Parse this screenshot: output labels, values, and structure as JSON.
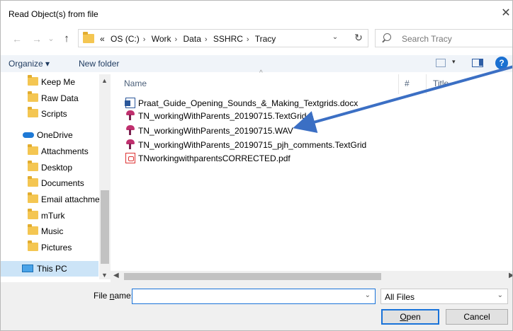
{
  "window": {
    "title": "Read Object(s) from file",
    "close_glyph": "✕"
  },
  "nav": {
    "back_glyph": "←",
    "forward_glyph": "→",
    "recent_glyph": "⌄",
    "up_glyph": "↑",
    "overflow": "«",
    "breadcrumbs": [
      "OS (C:)",
      "Work",
      "Data",
      "SSHRC",
      "Tracy"
    ],
    "sep": "›",
    "dropdown_glyph": "⌄",
    "refresh_glyph": "↻",
    "search_placeholder": "Search Tracy"
  },
  "toolbar": {
    "organize": "Organize ▾",
    "new_folder": "New folder",
    "view_dd": "▾",
    "help": "?"
  },
  "sidebar": {
    "items": [
      {
        "label": "Keep Me",
        "type": "folder"
      },
      {
        "label": "Raw Data",
        "type": "folder"
      },
      {
        "label": "Scripts",
        "type": "folder"
      },
      {
        "label": "OneDrive",
        "type": "onedrive"
      },
      {
        "label": "Attachments",
        "type": "folder"
      },
      {
        "label": "Desktop",
        "type": "folder"
      },
      {
        "label": "Documents",
        "type": "folder"
      },
      {
        "label": "Email attachmer",
        "type": "folder"
      },
      {
        "label": "mTurk",
        "type": "folder"
      },
      {
        "label": "Music",
        "type": "folder"
      },
      {
        "label": "Pictures",
        "type": "folder"
      },
      {
        "label": "This PC",
        "type": "thispc"
      }
    ],
    "scroll_up": "▲",
    "scroll_down": "▼"
  },
  "files": {
    "columns": [
      "Name",
      "#",
      "Title"
    ],
    "sort_caret": "^",
    "items": [
      {
        "name": "Praat_Guide_Opening_Sounds_&_Making_Textgrids.docx",
        "icon": "word-doc-icon"
      },
      {
        "name": "TN_workingWithParents_20190715.TextGrid",
        "icon": "praat-icon"
      },
      {
        "name": "TN_workingWithParents_20190715.WAV",
        "icon": "praat-icon"
      },
      {
        "name": "TN_workingWithParents_20190715_pjh_comments.TextGrid",
        "icon": "praat-icon"
      },
      {
        "name": "TNworkingwithparentsCORRECTED.pdf",
        "icon": "pdf-icon"
      }
    ]
  },
  "hscroll": {
    "left": "◀",
    "right": "▶"
  },
  "bottom": {
    "file_name_label_pre": "File ",
    "file_name_label_mn": "n",
    "file_name_label_post": "ame:",
    "file_name_value": "",
    "filetype": "All Files",
    "dropdown_glyph": "⌄",
    "open_mn": "O",
    "open_rest": "pen",
    "cancel": "Cancel"
  },
  "annotation": {
    "arrow_color": "#3b6fc4"
  }
}
